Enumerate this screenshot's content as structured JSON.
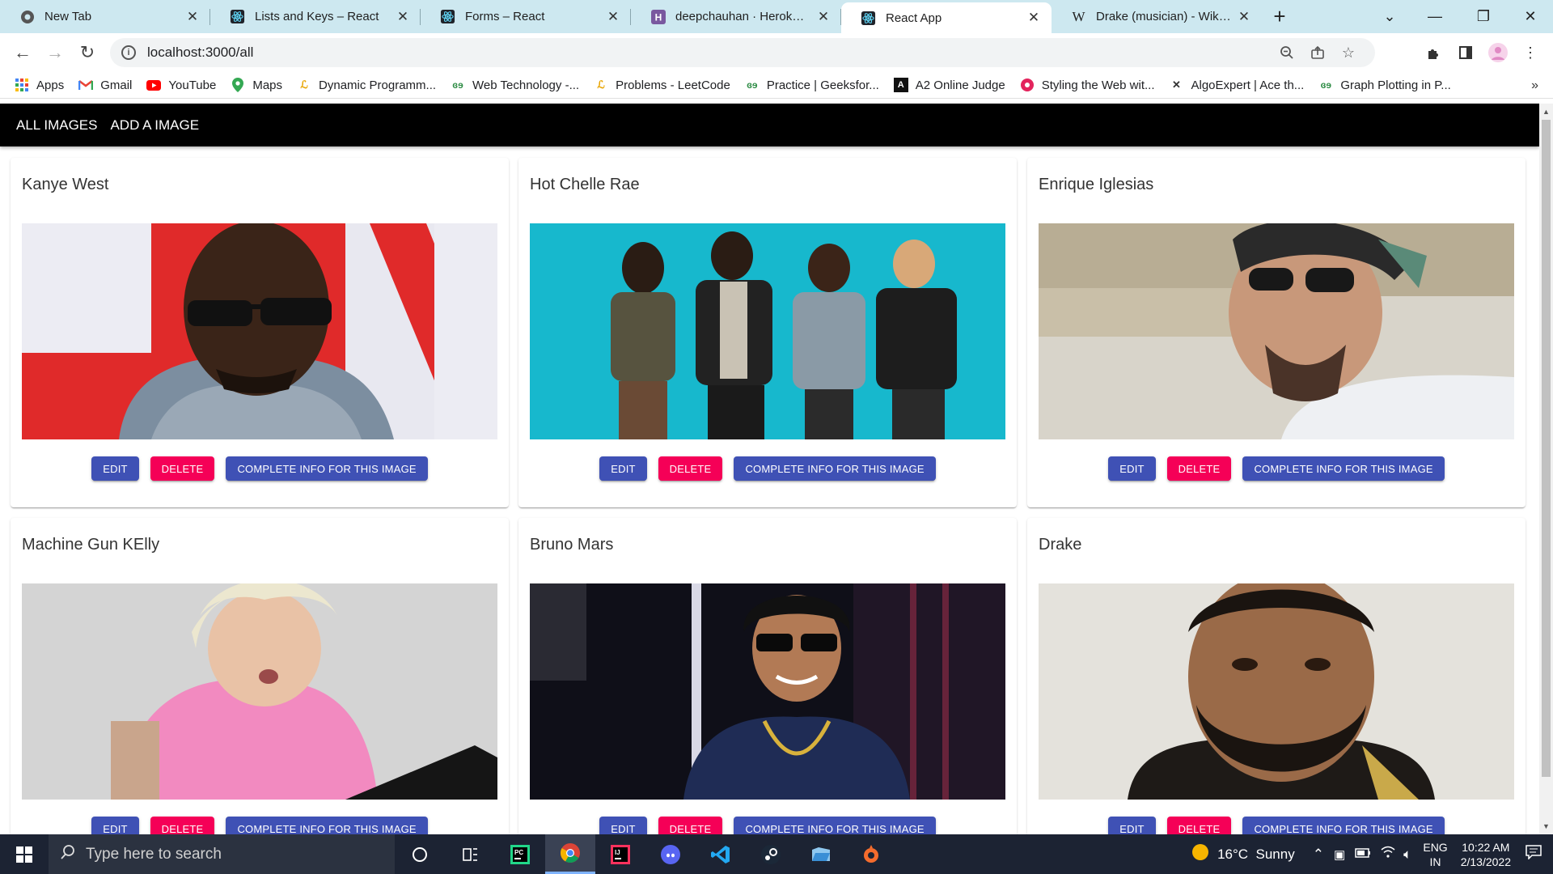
{
  "browser": {
    "tabs": [
      {
        "title": "New Tab",
        "icon": "chrome-icon"
      },
      {
        "title": "Lists and Keys – React",
        "icon": "react-icon"
      },
      {
        "title": "Forms – React",
        "icon": "react-icon"
      },
      {
        "title": "deepchauhan · Heroku-git |",
        "icon": "heroku-icon"
      },
      {
        "title": "React App",
        "icon": "react-icon",
        "active": true
      },
      {
        "title": "Drake (musician) - Wikipedi",
        "icon": "wikipedia-icon"
      }
    ],
    "new_tab": "+",
    "url": "localhost:3000/all",
    "bookmarks": [
      {
        "label": "Apps",
        "icon": "apps-grid-icon"
      },
      {
        "label": "Gmail",
        "icon": "gmail-icon"
      },
      {
        "label": "YouTube",
        "icon": "youtube-icon"
      },
      {
        "label": "Maps",
        "icon": "maps-icon"
      },
      {
        "label": "Dynamic Programm...",
        "icon": "bookmark-icon"
      },
      {
        "label": "Web Technology -...",
        "icon": "gfg-icon"
      },
      {
        "label": "Problems - LeetCode",
        "icon": "leetcode-icon"
      },
      {
        "label": "Practice | Geeksfor...",
        "icon": "gfg-icon"
      },
      {
        "label": "A2 Online Judge",
        "icon": "a2-icon"
      },
      {
        "label": "Styling the Web wit...",
        "icon": "bookmark-icon"
      },
      {
        "label": "AlgoExpert | Ace th...",
        "icon": "algoexpert-icon"
      },
      {
        "label": "Graph Plotting in P...",
        "icon": "gfg-icon"
      }
    ],
    "bookmarks_more": "»"
  },
  "nav": {
    "all_images": "All Images",
    "add_image": "Add a Image"
  },
  "cards": [
    {
      "name": "Kanye West",
      "photo": "kanye-west"
    },
    {
      "name": "Hot Chelle Rae",
      "photo": "hot-chelle-rae"
    },
    {
      "name": "Enrique Iglesias",
      "photo": "enrique-iglesias"
    },
    {
      "name": "Machine Gun KElly",
      "photo": "machine-gun-kelly"
    },
    {
      "name": "Bruno Mars",
      "photo": "bruno-mars"
    },
    {
      "name": "Drake",
      "photo": "drake"
    }
  ],
  "buttons": {
    "edit": "Edit",
    "delete": "Delete",
    "info": "Complete Info for this image"
  },
  "colors": {
    "primary": "#3f51b5",
    "secondary": "#f50057",
    "appbar": "#000000",
    "tabstrip": "#cde8f0"
  },
  "taskbar": {
    "search_placeholder": "Type here to search",
    "weather": "16°C  Sunny",
    "lang1": "ENG",
    "lang2": "IN",
    "time": "10:22 AM",
    "date": "2/13/2022"
  }
}
